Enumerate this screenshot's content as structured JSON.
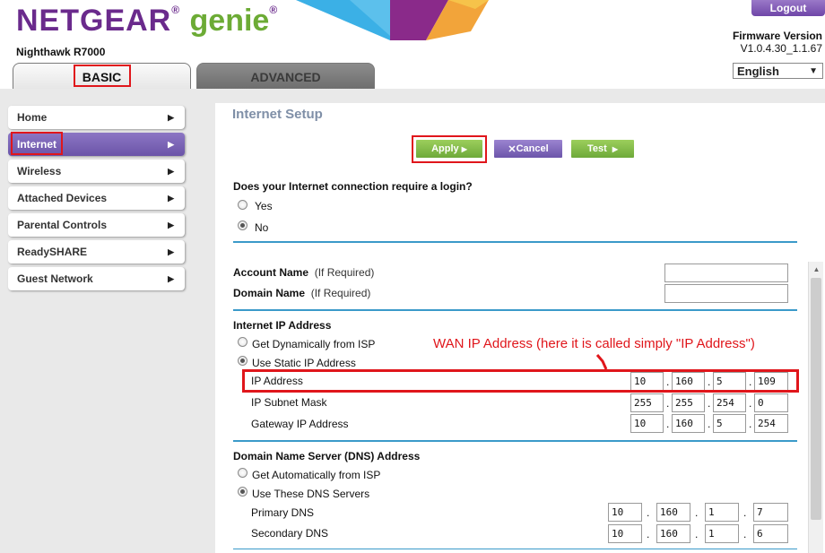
{
  "header": {
    "brand": "NETGEAR",
    "product": "genie",
    "registered_mark": "®",
    "model": "Nighthawk R7000",
    "logout_label": "Logout",
    "firmware_label": "Firmware Version",
    "firmware_value": "V1.0.4.30_1.1.67",
    "language": "English"
  },
  "tabs": {
    "basic": "BASIC",
    "advanced": "ADVANCED"
  },
  "sidebar": {
    "items": [
      {
        "label": "Home",
        "active": false
      },
      {
        "label": "Internet",
        "active": true
      },
      {
        "label": "Wireless",
        "active": false
      },
      {
        "label": "Attached Devices",
        "active": false
      },
      {
        "label": "Parental Controls",
        "active": false
      },
      {
        "label": "ReadySHARE",
        "active": false
      },
      {
        "label": "Guest Network",
        "active": false
      }
    ]
  },
  "main": {
    "title": "Internet Setup",
    "buttons": {
      "apply": "Apply",
      "cancel": "Cancel",
      "test": "Test"
    },
    "login_question": "Does your Internet connection require a login?",
    "login_yes": "Yes",
    "login_no": "No",
    "account_name_label": "Account Name",
    "domain_name_label": "Domain Name",
    "if_required": "(If Required)",
    "account_name_value": "",
    "domain_name_value": "",
    "ip_section_title": "Internet IP Address",
    "ip_dynamic": "Get Dynamically from ISP",
    "ip_static": "Use Static IP Address",
    "ip_address_label": "IP Address",
    "ip_address": [
      "10",
      "160",
      "5",
      "109"
    ],
    "subnet_label": "IP Subnet Mask",
    "subnet": [
      "255",
      "255",
      "254",
      "0"
    ],
    "gateway_label": "Gateway IP Address",
    "gateway": [
      "10",
      "160",
      "5",
      "254"
    ],
    "dns_section_title": "Domain Name Server (DNS) Address",
    "dns_auto": "Get Automatically from ISP",
    "dns_manual": "Use These DNS Servers",
    "primary_dns_label": "Primary DNS",
    "primary_dns": [
      "10",
      "160",
      "1",
      "7"
    ],
    "secondary_dns_label": "Secondary DNS",
    "secondary_dns": [
      "10",
      "160",
      "1",
      "6"
    ],
    "dot": "."
  },
  "annotation": {
    "note": "WAN IP Address (here it is called simply \"IP Address\")"
  },
  "icons": {
    "nav_arrow": "▶",
    "button_arrow": "▶",
    "cancel_x": "✕",
    "dropdown": "▼"
  },
  "colors": {
    "brand_purple": "#6a2a8c",
    "genie_green": "#6cab35",
    "highlight_red": "#e0161b",
    "rule_blue": "#3b9ac9",
    "active_nav": "#7b64b8"
  }
}
